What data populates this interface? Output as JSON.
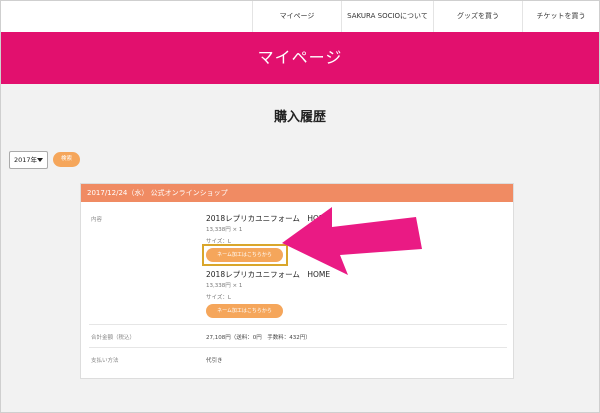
{
  "nav": {
    "items": [
      {
        "label": "マイページ"
      },
      {
        "label": "SAKURA SOCIOについて"
      },
      {
        "label": "グッズを買う"
      },
      {
        "label": "チケットを買う"
      }
    ]
  },
  "hero": {
    "title": "マイページ"
  },
  "page": {
    "title": "購入履歴"
  },
  "filter": {
    "year": "2017年",
    "search_label": "検索"
  },
  "order": {
    "header": "2017/12/24（水） 公式オンラインショップ",
    "content_label": "内容",
    "items": [
      {
        "name": "2018レプリカユニフォーム　HOME",
        "price": "13,338円 × 1",
        "size": "サイズ：L",
        "button": "ネーム加工はこちらから"
      },
      {
        "name": "2018レプリカユニフォーム　HOME",
        "price": "13,338円 × 1",
        "size": "サイズ：L",
        "button": "ネーム加工はこちらから"
      }
    ],
    "total_label": "合計金額（税込）",
    "total_value": "27,108円（送料：0円　手数料：432円）",
    "payment_label": "支払い方法",
    "payment_value": "代引き"
  },
  "colors": {
    "brand": "#e2106e",
    "accent": "#f5a65b",
    "card_header": "#f08b63",
    "arrow": "#ea1a84",
    "highlight": "#d9a62b"
  }
}
